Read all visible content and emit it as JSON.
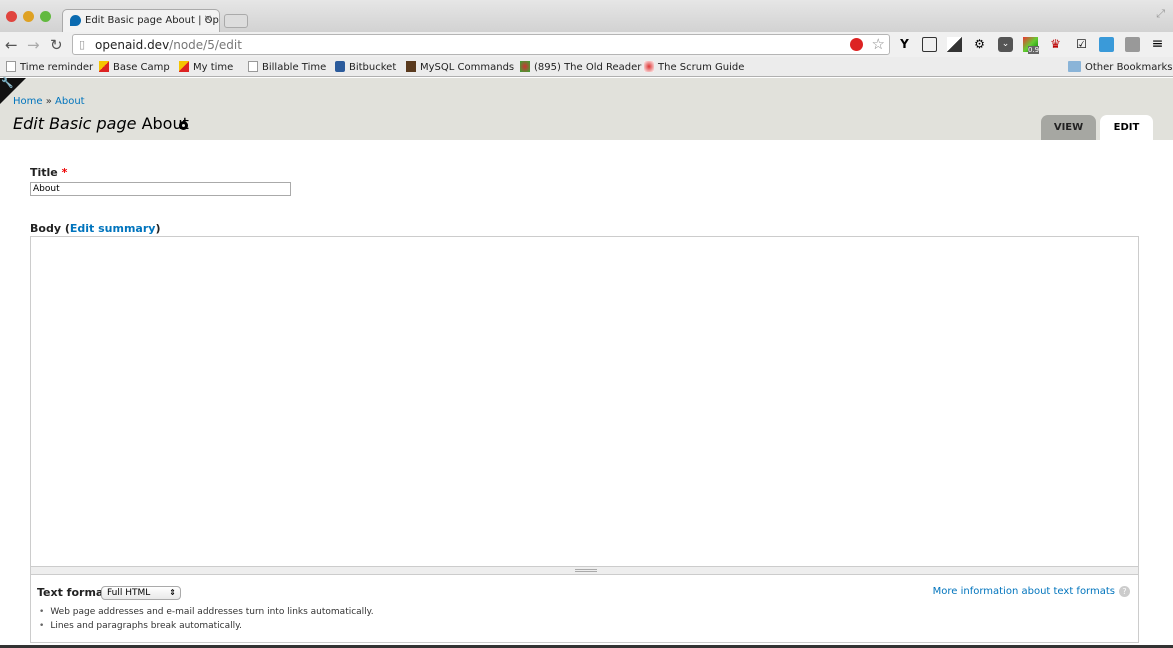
{
  "browser": {
    "tab_title": "Edit Basic page About | Op",
    "url_host": "openaid.dev",
    "url_path": "/node/5/edit",
    "extension_badge": "0.9",
    "bookmarks": [
      "Time reminder",
      "Base Camp",
      "My time",
      "Billable Time",
      "Bitbucket",
      "MySQL Commands",
      "(895) The Old Reader",
      "The Scrum Guide"
    ],
    "other_bookmarks": "Other Bookmarks"
  },
  "header": {
    "breadcrumb": [
      "Home",
      "About"
    ],
    "breadcrumb_sep": "»",
    "title_em": "Edit Basic page",
    "title_rest": "About",
    "tabs": [
      "VIEW",
      "EDIT"
    ]
  },
  "form": {
    "title_label": "Title",
    "required": "*",
    "title_value": "About",
    "body_label": "Body",
    "edit_summary": "Edit summary",
    "text_format_label": "Text format",
    "text_format_value": "Full HTML",
    "tips": [
      "Web page addresses and e-mail addresses turn into links automatically.",
      "Lines and paragraphs break automatically."
    ],
    "more_info": "More information about text formats",
    "help_glyph": "?"
  },
  "colors": {
    "link": "#0074bd",
    "header_bg": "#e1e1db"
  }
}
